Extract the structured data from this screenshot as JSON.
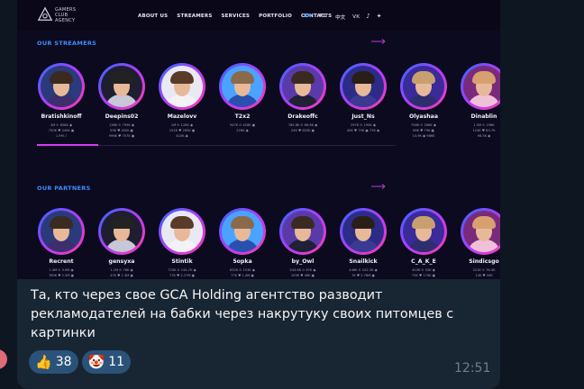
{
  "site": {
    "logo_lines": [
      "GAMERS",
      "CLUB",
      "AGENCY"
    ],
    "nav": [
      "ABOUT US",
      "STREAMERS",
      "SERVICES",
      "PORTFOLIO",
      "CONTACTS"
    ],
    "languages": [
      "EN",
      "RU",
      "中文"
    ],
    "active_language": "EN",
    "socials": [
      "vk-icon",
      "tiktok-icon",
      "twitter-icon"
    ],
    "streamers_title": "OUR STREAMERS",
    "partners_title": "OUR PARTNERS",
    "streamers": [
      {
        "name": "Bratishkinoff",
        "stats": [
          "3M ⊙ 858K ◉",
          "750K ♥ 440K ▣",
          "1.9M ♪"
        ]
      },
      {
        "name": "Deepins02",
        "stats": [
          "136K ⊙ 799K ◉",
          "59K ♥ 450k ▣",
          "996K ♥ 757K ▣"
        ]
      },
      {
        "name": "Mazelovv",
        "stats": [
          "1M ⊙ 128K ◉",
          "152K ♥ 285K ▣",
          "410K ◉"
        ]
      },
      {
        "name": "T2x2",
        "stats": [
          "947K ⊙ 426K ▣",
          "228K ◉"
        ]
      },
      {
        "name": "Drakeoffc",
        "stats": [
          "765.8K ⊙ 66.8K ◉",
          "24K ♥ 853K ▣"
        ]
      },
      {
        "name": "Just_Ns",
        "stats": [
          "297K ⊙ 190K ◉",
          "40K ♥ 79K ▣ 75K ◉"
        ]
      },
      {
        "name": "Olyashaa",
        "stats": [
          "758K ⊙ 266K ◉",
          "98K ♥ 79K ▣",
          "14.9K ◉ 986K"
        ]
      },
      {
        "name": "Dinablin",
        "stats": [
          "1.5M ⊙ 198K",
          "124K ♥ 83.7K",
          "96.5K ◉"
        ]
      }
    ],
    "partners": [
      {
        "name": "Recrent",
        "stats": [
          "1.4M ⊙ 3.9M ◉",
          "765K ♥ 2.5M ▣",
          "1.5M ◉"
        ]
      },
      {
        "name": "gensyxa",
        "stats": [
          "1.1M ⊙ 76K ◉",
          "47K ♥ 1.3M ▣",
          "1.1M ◉"
        ]
      },
      {
        "name": "Stintik",
        "stats": [
          "725K ⊙ 144.7K ◉",
          "77K ♥ 2.27M ▣",
          "87.2K ◉"
        ]
      },
      {
        "name": "5opka",
        "stats": [
          "632K ⊙ 153K ◉",
          "77K ♥ 1.4M ▣",
          "3.5M ◉"
        ]
      },
      {
        "name": "by_Owl",
        "stats": [
          "543.8K ⊙ 67K ◉",
          "109K ♥ 48K ▣",
          "66K ◉"
        ]
      },
      {
        "name": "Snailkick",
        "stats": [
          "446K ⊙ 242.3K ◉",
          "7K ♥ 2.78M ▣",
          "45K ◉ 8.2M"
        ]
      },
      {
        "name": "C_A_K_E",
        "stats": [
          "403K ⊙ 53K ◉",
          "73K ♥ 174K ▣",
          "25K ◉ 110K"
        ]
      },
      {
        "name": "Sindicsgo",
        "stats": [
          "221K ⊙ 76.3K",
          "14K ♥ 59K",
          "47.9K ◉"
        ]
      }
    ]
  },
  "message": {
    "text": "Та, кто через свое GCA Holding агентство разводит рекламодателей на бабки через накрутуку своих питомцев с картинки",
    "time": "12:51",
    "reactions": [
      {
        "emoji": "👍",
        "count": "38"
      },
      {
        "emoji": "🤡",
        "count": "11"
      }
    ]
  },
  "colors": {
    "chat_background": "#0e1621",
    "bubble": "#182533",
    "reaction_pill": "#2b5278",
    "accent_blue": "#3f8cff",
    "accent_pink": "#d43cf0"
  }
}
